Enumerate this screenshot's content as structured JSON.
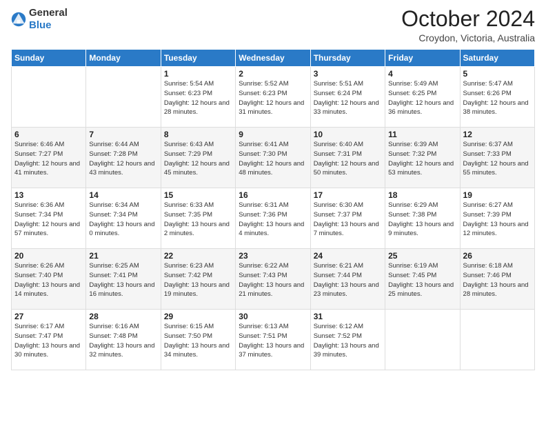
{
  "logo": {
    "general": "General",
    "blue": "Blue"
  },
  "header": {
    "month": "October 2024",
    "location": "Croydon, Victoria, Australia"
  },
  "weekdays": [
    "Sunday",
    "Monday",
    "Tuesday",
    "Wednesday",
    "Thursday",
    "Friday",
    "Saturday"
  ],
  "weeks": [
    [
      {
        "day": "",
        "detail": ""
      },
      {
        "day": "",
        "detail": ""
      },
      {
        "day": "1",
        "detail": "Sunrise: 5:54 AM\nSunset: 6:23 PM\nDaylight: 12 hours\nand 28 minutes."
      },
      {
        "day": "2",
        "detail": "Sunrise: 5:52 AM\nSunset: 6:23 PM\nDaylight: 12 hours\nand 31 minutes."
      },
      {
        "day": "3",
        "detail": "Sunrise: 5:51 AM\nSunset: 6:24 PM\nDaylight: 12 hours\nand 33 minutes."
      },
      {
        "day": "4",
        "detail": "Sunrise: 5:49 AM\nSunset: 6:25 PM\nDaylight: 12 hours\nand 36 minutes."
      },
      {
        "day": "5",
        "detail": "Sunrise: 5:47 AM\nSunset: 6:26 PM\nDaylight: 12 hours\nand 38 minutes."
      }
    ],
    [
      {
        "day": "6",
        "detail": "Sunrise: 6:46 AM\nSunset: 7:27 PM\nDaylight: 12 hours\nand 41 minutes."
      },
      {
        "day": "7",
        "detail": "Sunrise: 6:44 AM\nSunset: 7:28 PM\nDaylight: 12 hours\nand 43 minutes."
      },
      {
        "day": "8",
        "detail": "Sunrise: 6:43 AM\nSunset: 7:29 PM\nDaylight: 12 hours\nand 45 minutes."
      },
      {
        "day": "9",
        "detail": "Sunrise: 6:41 AM\nSunset: 7:30 PM\nDaylight: 12 hours\nand 48 minutes."
      },
      {
        "day": "10",
        "detail": "Sunrise: 6:40 AM\nSunset: 7:31 PM\nDaylight: 12 hours\nand 50 minutes."
      },
      {
        "day": "11",
        "detail": "Sunrise: 6:39 AM\nSunset: 7:32 PM\nDaylight: 12 hours\nand 53 minutes."
      },
      {
        "day": "12",
        "detail": "Sunrise: 6:37 AM\nSunset: 7:33 PM\nDaylight: 12 hours\nand 55 minutes."
      }
    ],
    [
      {
        "day": "13",
        "detail": "Sunrise: 6:36 AM\nSunset: 7:34 PM\nDaylight: 12 hours\nand 57 minutes."
      },
      {
        "day": "14",
        "detail": "Sunrise: 6:34 AM\nSunset: 7:34 PM\nDaylight: 13 hours\nand 0 minutes."
      },
      {
        "day": "15",
        "detail": "Sunrise: 6:33 AM\nSunset: 7:35 PM\nDaylight: 13 hours\nand 2 minutes."
      },
      {
        "day": "16",
        "detail": "Sunrise: 6:31 AM\nSunset: 7:36 PM\nDaylight: 13 hours\nand 4 minutes."
      },
      {
        "day": "17",
        "detail": "Sunrise: 6:30 AM\nSunset: 7:37 PM\nDaylight: 13 hours\nand 7 minutes."
      },
      {
        "day": "18",
        "detail": "Sunrise: 6:29 AM\nSunset: 7:38 PM\nDaylight: 13 hours\nand 9 minutes."
      },
      {
        "day": "19",
        "detail": "Sunrise: 6:27 AM\nSunset: 7:39 PM\nDaylight: 13 hours\nand 12 minutes."
      }
    ],
    [
      {
        "day": "20",
        "detail": "Sunrise: 6:26 AM\nSunset: 7:40 PM\nDaylight: 13 hours\nand 14 minutes."
      },
      {
        "day": "21",
        "detail": "Sunrise: 6:25 AM\nSunset: 7:41 PM\nDaylight: 13 hours\nand 16 minutes."
      },
      {
        "day": "22",
        "detail": "Sunrise: 6:23 AM\nSunset: 7:42 PM\nDaylight: 13 hours\nand 19 minutes."
      },
      {
        "day": "23",
        "detail": "Sunrise: 6:22 AM\nSunset: 7:43 PM\nDaylight: 13 hours\nand 21 minutes."
      },
      {
        "day": "24",
        "detail": "Sunrise: 6:21 AM\nSunset: 7:44 PM\nDaylight: 13 hours\nand 23 minutes."
      },
      {
        "day": "25",
        "detail": "Sunrise: 6:19 AM\nSunset: 7:45 PM\nDaylight: 13 hours\nand 25 minutes."
      },
      {
        "day": "26",
        "detail": "Sunrise: 6:18 AM\nSunset: 7:46 PM\nDaylight: 13 hours\nand 28 minutes."
      }
    ],
    [
      {
        "day": "27",
        "detail": "Sunrise: 6:17 AM\nSunset: 7:47 PM\nDaylight: 13 hours\nand 30 minutes."
      },
      {
        "day": "28",
        "detail": "Sunrise: 6:16 AM\nSunset: 7:48 PM\nDaylight: 13 hours\nand 32 minutes."
      },
      {
        "day": "29",
        "detail": "Sunrise: 6:15 AM\nSunset: 7:50 PM\nDaylight: 13 hours\nand 34 minutes."
      },
      {
        "day": "30",
        "detail": "Sunrise: 6:13 AM\nSunset: 7:51 PM\nDaylight: 13 hours\nand 37 minutes."
      },
      {
        "day": "31",
        "detail": "Sunrise: 6:12 AM\nSunset: 7:52 PM\nDaylight: 13 hours\nand 39 minutes."
      },
      {
        "day": "",
        "detail": ""
      },
      {
        "day": "",
        "detail": ""
      }
    ]
  ]
}
